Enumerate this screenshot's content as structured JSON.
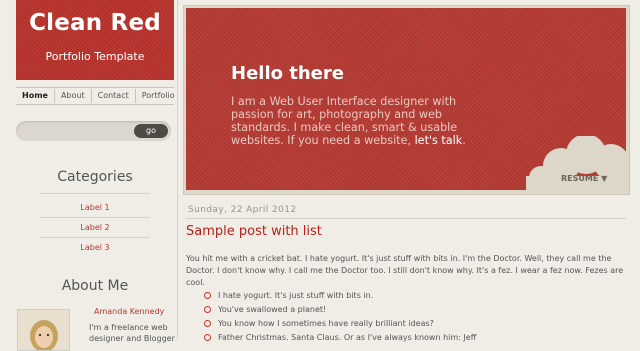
{
  "site": {
    "title": "Clean Red",
    "subtitle": "Portfolio Template"
  },
  "nav": {
    "items": [
      "Home",
      "About",
      "Contact",
      "Portfolio"
    ],
    "active": "Home"
  },
  "search": {
    "placeholder": "",
    "button_label": "go"
  },
  "categories": {
    "title": "Categories",
    "items": [
      "Label 1",
      "Label 2",
      "Label 3"
    ]
  },
  "about": {
    "title": "About Me",
    "name": "Amanda Kennedy",
    "text": "I'm a freelance web designer and Blogger"
  },
  "hero": {
    "title": "Hello there",
    "text": "I am a Web User Interface designer with passion for art, photography and web standards. I make clean, smart & usable websites. If you need a website,",
    "link": "let's talk",
    "after_link": ".",
    "resume_label": "RESUME"
  },
  "post": {
    "date": "Sunday, 22 April 2012",
    "title": "Sample post with list",
    "body": "You hit me with a cricket bat. I hate yogurt. It's just stuff with bits in. I'm the Doctor. Well, they call me the Doctor. I don't know why. I call me the Doctor too. I still don't know why. It's a fez. I wear a fez now. Fezes are cool.",
    "list": [
      "I hate yogurt. It's just stuff with bits in.",
      "You've swallowed a planet!",
      "You know how I sometimes have really brilliant ideas?",
      "Father Christmas. Santa Claus. Or as I've always known him: Jeff"
    ]
  },
  "colors": {
    "accent": "#b8332c",
    "background": "#f0ede6",
    "link": "#b23a30"
  },
  "icons": {
    "resume": "triangle-down-icon"
  }
}
